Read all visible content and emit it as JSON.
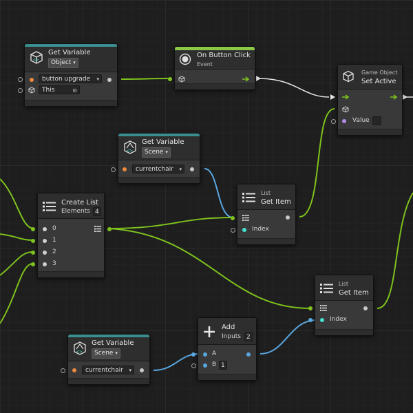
{
  "nodes": {
    "get_var_1": {
      "title": "Get Variable",
      "kind": "Object",
      "variable": "button upgrade",
      "target": "This"
    },
    "on_click": {
      "title": "On Button Click",
      "subtitle": "Event"
    },
    "set_active": {
      "title_small": "Game Object",
      "title": "Set Active",
      "value_label": "Value"
    },
    "get_var_2": {
      "title": "Get Variable",
      "kind": "Scene",
      "variable": "currentchair"
    },
    "list_get_1": {
      "title_small": "List",
      "title": "Get Item",
      "index_label": "Index"
    },
    "create_list": {
      "title": "Create List",
      "elements_label": "Elements",
      "elements_count": "4",
      "items": [
        "0",
        "1",
        "2",
        "3"
      ]
    },
    "list_get_2": {
      "title_small": "List",
      "title": "Get Item",
      "index_label": "Index"
    },
    "get_var_3": {
      "title": "Get Variable",
      "kind": "Scene",
      "variable": "currentchair"
    },
    "add": {
      "title": "Add",
      "inputs_label": "Inputs",
      "inputs_count": "2",
      "a_label": "A",
      "b_label": "B",
      "b_value": "1"
    }
  },
  "colors": {
    "control_flow": "#7ec21d",
    "data_flow": "#5aa7e0",
    "teal_header": "#3a8e8f",
    "event_header": "#8bc84a",
    "flow_white": "#e8e8e8"
  }
}
